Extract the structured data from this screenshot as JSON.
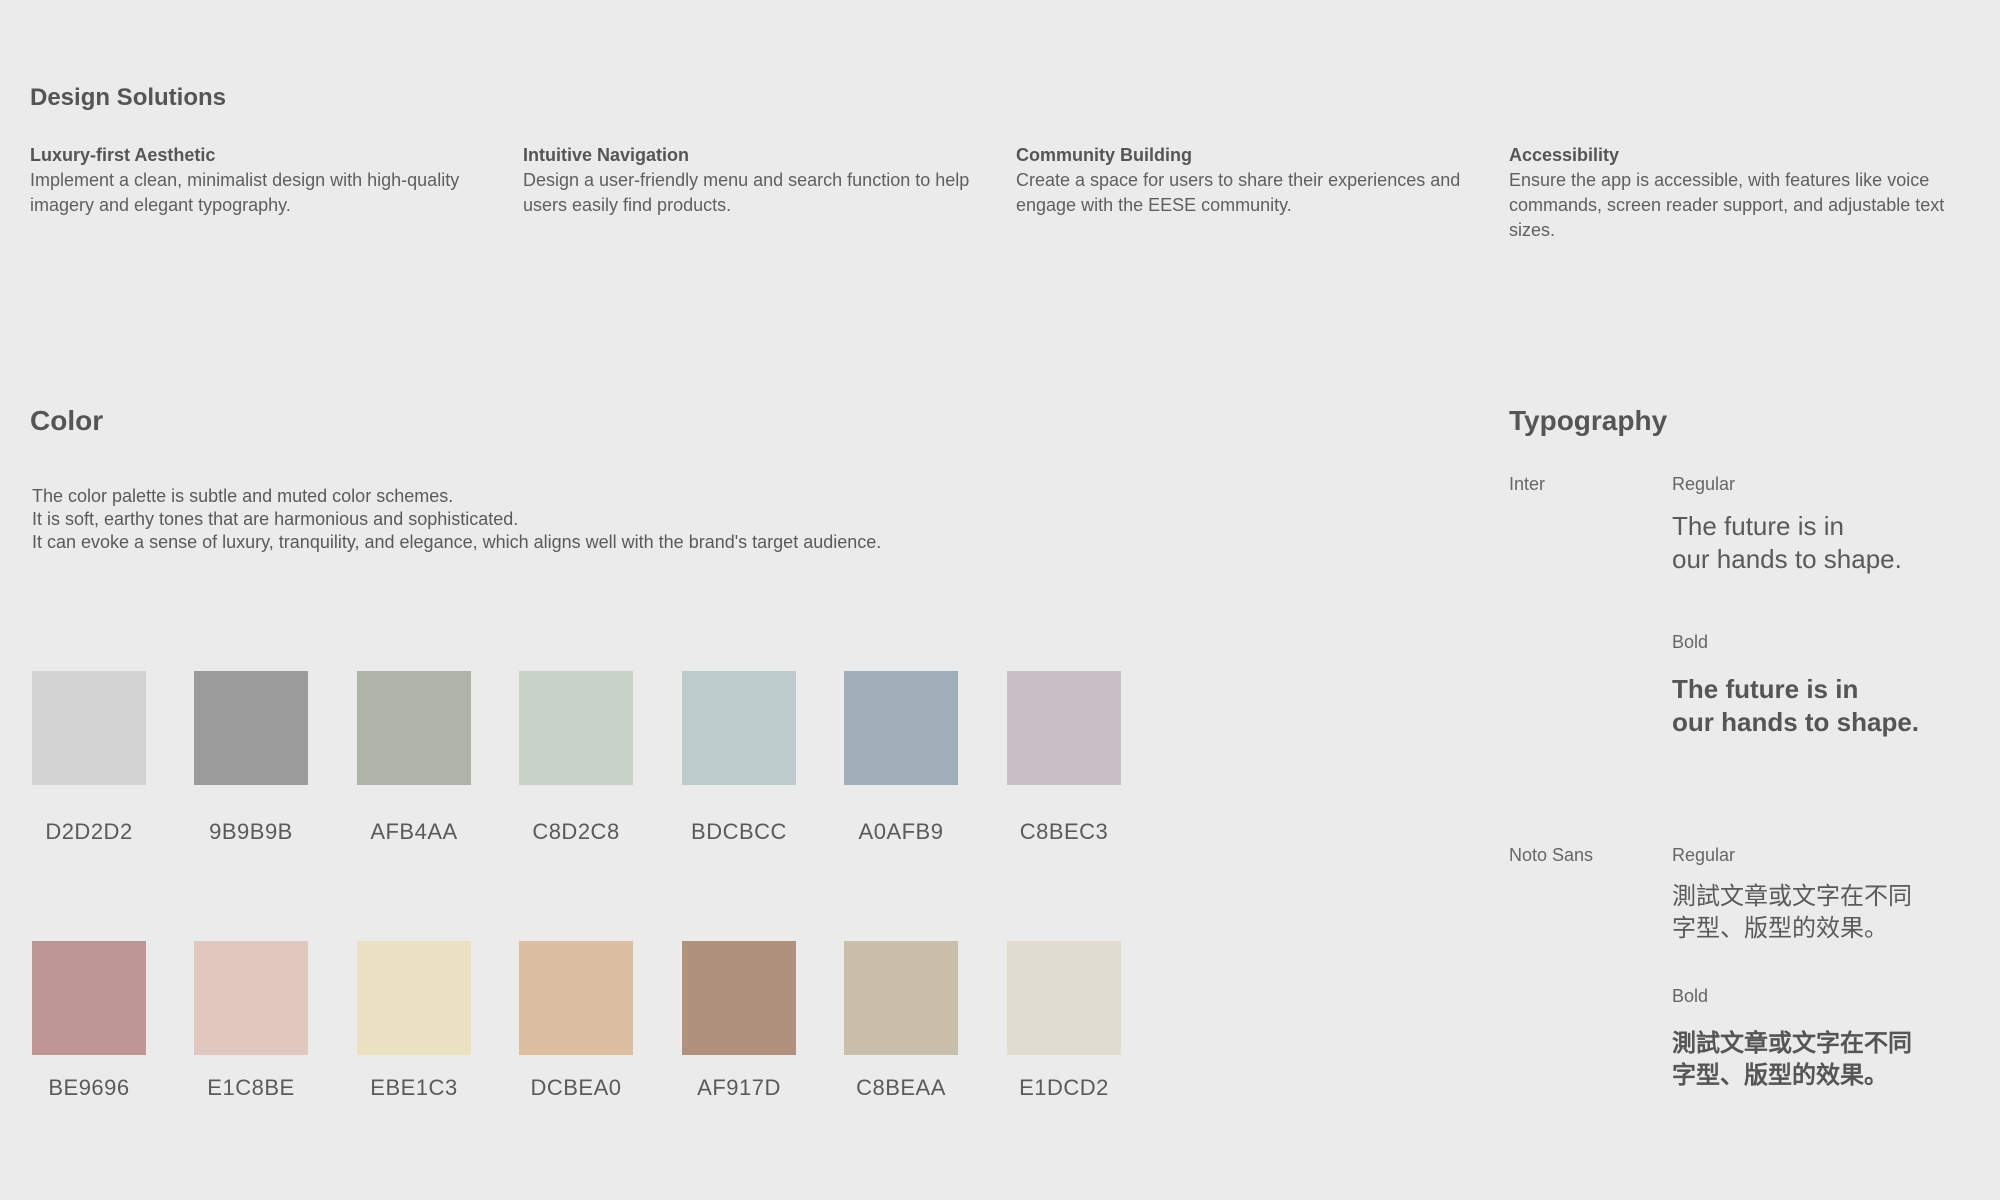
{
  "design_solutions": {
    "heading": "Design Solutions",
    "items": [
      {
        "title": "Luxury-first Aesthetic",
        "desc": "Implement a clean, minimalist design with high-quality imagery and elegant typography."
      },
      {
        "title": "Intuitive Navigation",
        "desc": "Design a user-friendly menu and search function to help users easily find products."
      },
      {
        "title": "Community Building",
        "desc": "Create a space for users to share their experiences and engage with the EESE community."
      },
      {
        "title": "Accessibility",
        "desc": "Ensure the app is accessible, with features like voice commands, screen reader support, and adjustable text sizes."
      }
    ]
  },
  "color": {
    "heading": "Color",
    "desc_lines": [
      "The color palette is subtle and muted color schemes.",
      "It is soft, earthy tones that are harmonious and sophisticated.",
      "It can evoke a sense of luxury, tranquility, and elegance, which aligns well with the brand's target audience."
    ],
    "row1": [
      {
        "hex": "#D2D2D2",
        "label": "D2D2D2"
      },
      {
        "hex": "#9B9B9B",
        "label": "9B9B9B"
      },
      {
        "hex": "#AFB4AA",
        "label": "AFB4AA"
      },
      {
        "hex": "#C8D2C8",
        "label": "C8D2C8"
      },
      {
        "hex": "#BDCBCC",
        "label": "BDCBCC"
      },
      {
        "hex": "#A0AFB9",
        "label": "A0AFB9"
      },
      {
        "hex": "#C8BEC3",
        "label": "C8BEC3"
      }
    ],
    "row2": [
      {
        "hex": "#BE9696",
        "label": "BE9696"
      },
      {
        "hex": "#E1C8BE",
        "label": "E1C8BE"
      },
      {
        "hex": "#EBE1C3",
        "label": "EBE1C3"
      },
      {
        "hex": "#DCBEA0",
        "label": "DCBEA0"
      },
      {
        "hex": "#AF917D",
        "label": "AF917D"
      },
      {
        "hex": "#C8BEAA",
        "label": "C8BEAA"
      },
      {
        "hex": "#E1DCD2",
        "label": "E1DCD2"
      }
    ]
  },
  "typography": {
    "heading": "Typography",
    "fonts": [
      {
        "name": "Inter",
        "regular_label": "Regular",
        "regular_lines": [
          "The future is in",
          "our hands to shape."
        ],
        "bold_label": "Bold",
        "bold_lines": [
          "The future is in",
          "our hands to shape."
        ]
      },
      {
        "name": "Noto Sans",
        "regular_label": "Regular",
        "regular_lines": [
          "測試文章或文字在不同",
          "字型、版型的效果。"
        ],
        "bold_label": "Bold",
        "bold_lines": [
          "測試文章或文字在不同",
          "字型、版型的效果。"
        ]
      }
    ]
  }
}
